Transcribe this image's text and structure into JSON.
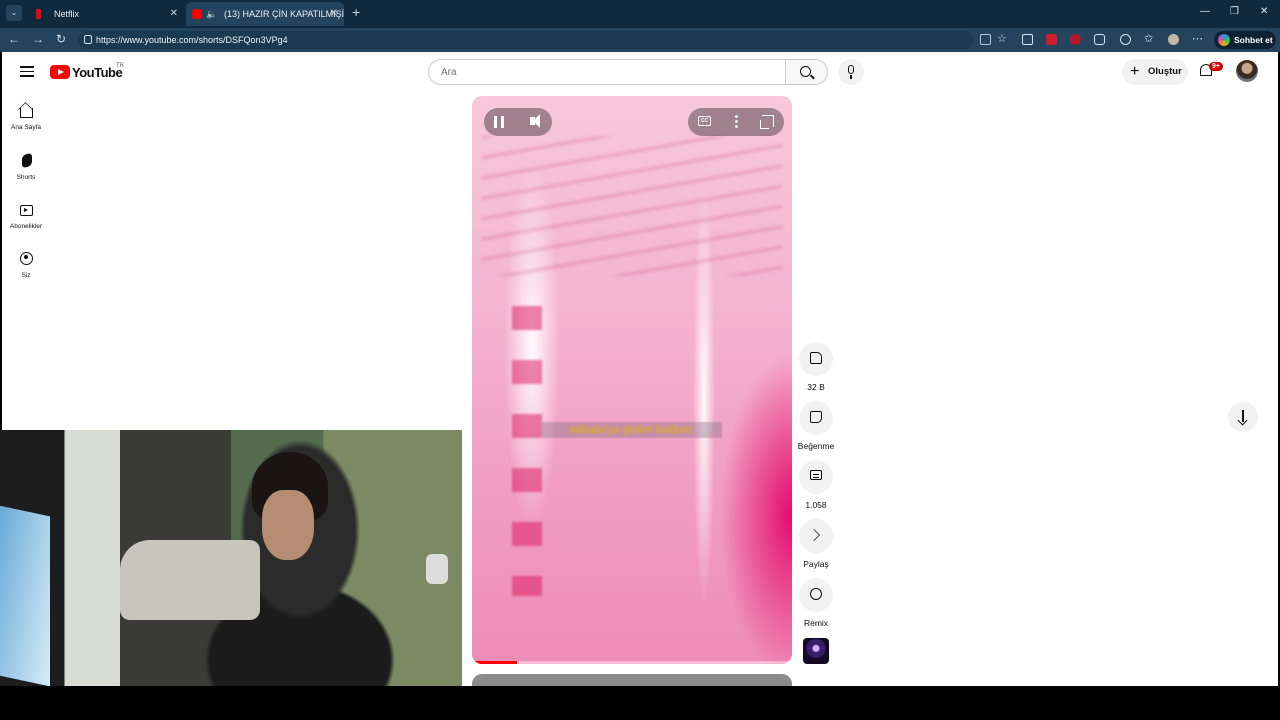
{
  "browser": {
    "tabs": [
      {
        "title": "Netflix",
        "favicon": "netflix-icon"
      },
      {
        "title": "(13) HAZIR ÇİN KAPATILMIŞİ",
        "favicon": "youtube-icon",
        "audio": "speaker-icon"
      }
    ],
    "url": "https://www.youtube.com/shorts/DSFQon3VPg4",
    "copilot_label": "Sohbet et"
  },
  "youtube": {
    "logo_text": "YouTube",
    "country_code": "TR",
    "search_placeholder": "Ara",
    "create_label": "Oluştur",
    "notification_count": "9+",
    "sidebar": [
      {
        "label": "Ana Sayfa",
        "icon": "home-icon"
      },
      {
        "label": "Shorts",
        "icon": "shorts-icon"
      },
      {
        "label": "Abonelikler",
        "icon": "subscriptions-icon"
      },
      {
        "label": "Siz",
        "icon": "you-icon"
      }
    ],
    "short": {
      "caption": "Alibaba'ya girdim buldum,",
      "progress": 0.14,
      "actions": [
        {
          "label": "32 B",
          "icon": "like-icon"
        },
        {
          "label": "Beğenme",
          "icon": "dislike-icon"
        },
        {
          "label": "1.058",
          "icon": "comment-icon"
        },
        {
          "label": "Paylaş",
          "icon": "share-icon"
        },
        {
          "label": "Remix",
          "icon": "remix-icon"
        }
      ]
    }
  },
  "colors": {
    "titlebar": "#0f2a3f",
    "toolbar": "#24445e",
    "youtube_red": "#ff0000",
    "video_pink": "#f4b2cd",
    "caption_yellow": "#d9b400"
  }
}
